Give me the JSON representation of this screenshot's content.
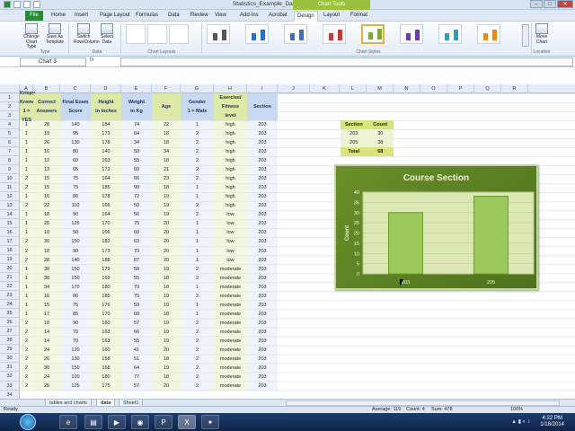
{
  "window": {
    "title": "Statistics_Example_Data - Microsoft Excel",
    "context_tab": "Chart Tools"
  },
  "ribbon_tabs": [
    "File",
    "Home",
    "Insert",
    "Page Layout",
    "Formulas",
    "Data",
    "Review",
    "View",
    "Add-Ins",
    "Acrobat",
    "Design",
    "Layout",
    "Format"
  ],
  "ribbon": {
    "buttons": [
      {
        "label": "Change Chart Type",
        "icon": "chart-type-icon"
      },
      {
        "label": "Save As Template",
        "icon": "save-template-icon"
      },
      {
        "label": "Switch Row/Column",
        "icon": "switch-icon"
      },
      {
        "label": "Select Data",
        "icon": "select-data-icon"
      },
      {
        "label": "Move Chart",
        "icon": "move-chart-icon"
      }
    ],
    "groups": [
      "Type",
      "Data",
      "Chart Layouts",
      "Chart Styles",
      "Location"
    ]
  },
  "formula_bar": {
    "name_box": "Chart 3",
    "fx": "fx",
    "value": ""
  },
  "columns": [
    "A",
    "B",
    "C",
    "D",
    "E",
    "F",
    "G",
    "H",
    "I",
    "J",
    "K",
    "L",
    "M",
    "N",
    "O",
    "P",
    "Q",
    "R"
  ],
  "headers": [
    [
      "Krispy",
      "Kreme",
      "1 = YES"
    ],
    [
      "Correct",
      "Answers"
    ],
    [
      "Final Exam",
      "Score"
    ],
    [
      "Height",
      "in inches"
    ],
    [
      "Weight",
      "in Kg"
    ],
    [
      "Age"
    ],
    [
      "Gender",
      "1 = Male"
    ],
    [
      "Exercise/",
      "Fitness",
      "level"
    ],
    [
      "Section"
    ]
  ],
  "rows": [
    [
      1,
      28,
      140,
      184,
      74,
      22,
      1,
      "high",
      203
    ],
    [
      1,
      19,
      95,
      173,
      64,
      18,
      2,
      "high",
      203
    ],
    [
      1,
      26,
      130,
      178,
      34,
      18,
      2,
      "high",
      203
    ],
    [
      1,
      16,
      80,
      140,
      50,
      34,
      2,
      "high",
      203
    ],
    [
      1,
      12,
      60,
      163,
      55,
      18,
      2,
      "high",
      203
    ],
    [
      1,
      13,
      65,
      172,
      60,
      21,
      2,
      "high",
      203
    ],
    [
      2,
      15,
      75,
      164,
      66,
      23,
      2,
      "high",
      203
    ],
    [
      2,
      15,
      75,
      185,
      90,
      18,
      1,
      "high",
      203
    ],
    [
      1,
      16,
      80,
      178,
      72,
      19,
      1,
      "high",
      203
    ],
    [
      2,
      22,
      110,
      166,
      50,
      19,
      2,
      "high",
      203
    ],
    [
      1,
      18,
      90,
      164,
      56,
      19,
      2,
      "low",
      203
    ],
    [
      1,
      25,
      125,
      170,
      75,
      20,
      1,
      "low",
      203
    ],
    [
      1,
      10,
      50,
      166,
      60,
      20,
      1,
      "low",
      203
    ],
    [
      2,
      30,
      150,
      182,
      63,
      20,
      1,
      "low",
      203
    ],
    [
      2,
      18,
      90,
      173,
      70,
      20,
      1,
      "low",
      203
    ],
    [
      2,
      28,
      140,
      188,
      87,
      20,
      1,
      "low",
      203
    ],
    [
      1,
      30,
      150,
      179,
      58,
      19,
      2,
      "moderate",
      203
    ],
    [
      1,
      30,
      150,
      169,
      55,
      18,
      2,
      "moderate",
      203
    ],
    [
      1,
      34,
      170,
      180,
      70,
      18,
      1,
      "moderate",
      203
    ],
    [
      1,
      16,
      80,
      185,
      75,
      19,
      2,
      "moderate",
      203
    ],
    [
      1,
      15,
      75,
      176,
      59,
      19,
      1,
      "moderate",
      203
    ],
    [
      1,
      17,
      85,
      170,
      60,
      18,
      1,
      "moderate",
      203
    ],
    [
      2,
      18,
      90,
      160,
      57,
      19,
      2,
      "moderate",
      203
    ],
    [
      2,
      14,
      70,
      163,
      66,
      19,
      2,
      "moderate",
      203
    ],
    [
      2,
      14,
      70,
      163,
      55,
      19,
      2,
      "moderate",
      203
    ],
    [
      2,
      24,
      120,
      160,
      41,
      20,
      2,
      "moderate",
      203
    ],
    [
      2,
      26,
      130,
      158,
      51,
      18,
      2,
      "moderate",
      203
    ],
    [
      2,
      30,
      150,
      168,
      64,
      19,
      2,
      "moderate",
      203
    ],
    [
      2,
      24,
      120,
      180,
      77,
      18,
      2,
      "moderate",
      203
    ],
    [
      2,
      25,
      125,
      175,
      57,
      20,
      2,
      "moderate",
      203
    ]
  ],
  "summary": {
    "headers": [
      "Section",
      "Count"
    ],
    "rows": [
      [
        "203",
        "30"
      ],
      [
        "205",
        "38"
      ]
    ],
    "total_label": "Total",
    "total": "68"
  },
  "chart_data": {
    "type": "bar",
    "title": "Course Section",
    "categories": [
      "203",
      "205"
    ],
    "values": [
      30,
      38
    ],
    "ylabel": "Count",
    "ylim": [
      0,
      40
    ],
    "yticks": [
      0,
      5,
      10,
      15,
      20,
      25,
      30,
      35,
      40
    ],
    "grid": true
  },
  "sheet_tabs": [
    "tables and charts",
    "data",
    "Sheet1"
  ],
  "active_sheet": "data",
  "status": {
    "ready": "Ready",
    "average": "Average: 119",
    "count": "Count: 4",
    "sum": "Sum: 478",
    "zoom": "100%"
  },
  "clock": {
    "time": "4:22 PM",
    "date": "1/18/2014"
  },
  "colors": {
    "header_yellow": "#dfe9a7",
    "header_blue": "#c9daf0",
    "chart_green": "#5c7f22",
    "bar_green": "#9bc85a"
  }
}
